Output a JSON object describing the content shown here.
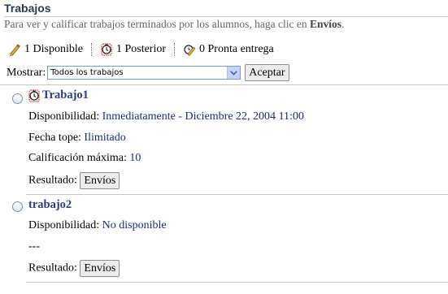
{
  "header": {
    "title": "Trabajos",
    "intro_prefix": "Para ver y calificar trabajos terminados por los alumnos, haga clic en ",
    "intro_link": "Envíos",
    "intro_suffix": "."
  },
  "legend": [
    {
      "icon": "pencil-icon",
      "text": "1 Disponible"
    },
    {
      "icon": "clock-icon",
      "text": "1 Posterior"
    },
    {
      "icon": "pencil-clock-icon",
      "text": "0 Pronta entrega"
    }
  ],
  "filter": {
    "label": "Mostrar:",
    "selected": "Todos los trabajos",
    "accept_label": "Aceptar"
  },
  "assignments": [
    {
      "title": "Trabajo1",
      "availability_label": "Disponibilidad:",
      "availability_value": "Inmediatamente - Diciembre 22, 2004 11:00",
      "due_label": "Fecha tope:",
      "due_value": "Ilimitado",
      "max_label": "Calificación máxima:",
      "max_value": "10",
      "result_label": "Resultado:",
      "result_button": "Envíos"
    },
    {
      "title": "trabajo2",
      "availability_label": "Disponibilidad:",
      "availability_value": "No disponible",
      "placeholder": "---",
      "result_label": "Resultado:",
      "result_button": "Envíos"
    }
  ],
  "colors": {
    "heading": "#2b3a55",
    "link": "#1a2a7a",
    "title_link": "#2b3a8c"
  }
}
